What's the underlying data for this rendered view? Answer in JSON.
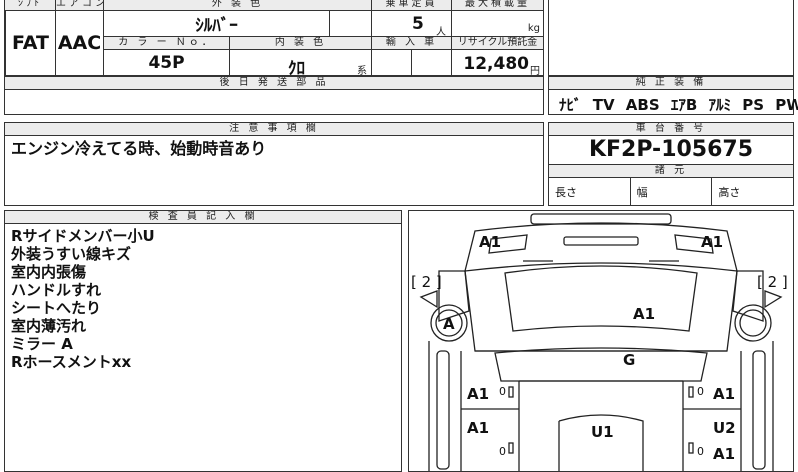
{
  "top": {
    "col_labels": [
      "ｼﾌﾄ",
      "エアコン",
      "外 装 色",
      "乗車定員",
      "最大積載量"
    ],
    "shift": "FAT",
    "aircon": "AAC",
    "exterior_color": "ｼﾙﾊﾞｰ",
    "capacity": "5",
    "capacity_unit": "人",
    "load_unit": "kg",
    "color_no_label": "カ ラ ー Ｎｏ．",
    "interior_color_label": "内 装 色",
    "import_label": "輸 入 車",
    "recycle_label": "リサイクル預託金",
    "color_no": "45P",
    "interior_color": "ｸﾛ",
    "interior_suffix": "系",
    "recycle_fee": "12,480",
    "recycle_unit": "円"
  },
  "later_parts": {
    "header": "後 日 発 送 部 品"
  },
  "equipment": {
    "header": "純 正 装 備",
    "items": "ﾅﾋﾞ TV ABS ｴｱB ｱﾙﾐ PS PW"
  },
  "notes": {
    "header": "注 意 事 項 欄",
    "text": "エンジン冷えてる時、始動時音あり"
  },
  "chassis": {
    "header": "車 台 番 号",
    "number": "KF2P-105675",
    "spec_header": "諸 元",
    "length_label": "長さ",
    "width_label": "幅",
    "height_label": "高さ"
  },
  "inspector": {
    "header": "検 査 員 記 入 欄",
    "lines": [
      "Rサイドメンバー小U",
      "外装うすい線キズ",
      "室内内張傷",
      "ハンドルすれ",
      "シートへたり",
      "室内薄汚れ",
      "ミラー A",
      "Rホースメントxx"
    ]
  },
  "diagram": {
    "front_left": "A1",
    "front_right": "A1",
    "left_bracket": "[ 2 ]",
    "right_bracket": "[ 2 ]",
    "wheel_left": "A",
    "hood": "A1",
    "roof": "G",
    "door_l1": "A1",
    "door_l1_small": "0",
    "door_r1": "A1",
    "door_r1_small": "0",
    "door_l2": "A1",
    "door_l2_small": "0",
    "door_r2": "U2",
    "door_r2_small": "0",
    "door_r2b": "A1",
    "center": "U1"
  }
}
